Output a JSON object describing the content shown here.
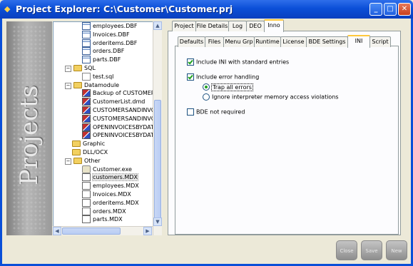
{
  "window": {
    "title": "Project Explorer: C:\\Customer\\Customer.prj",
    "title_icon": "diamond-icon",
    "controls": [
      "minimize-icon",
      "maximize-icon",
      "close-icon"
    ]
  },
  "banner": {
    "text": "Projects"
  },
  "tree": {
    "items": [
      {
        "label": "employees.DBF",
        "icon": "dbf-table-icon"
      },
      {
        "label": "Invoices.DBF",
        "icon": "dbf-table-icon"
      },
      {
        "label": "orderitems.DBF",
        "icon": "dbf-table-icon"
      },
      {
        "label": "orders.DBF",
        "icon": "dbf-table-icon"
      },
      {
        "label": "parts.DBF",
        "icon": "dbf-table-icon"
      },
      {
        "label": "SQL",
        "icon": "folder-icon",
        "expander": "−"
      },
      {
        "label": "test.sql",
        "icon": "sql-file-icon"
      },
      {
        "label": "Datamodule",
        "icon": "folder-icon",
        "expander": "−"
      },
      {
        "label": "Backup of CUSTOMERS",
        "icon": "datamodule-icon"
      },
      {
        "label": "CustomerList.dmd",
        "icon": "datamodule-icon"
      },
      {
        "label": "CUSTOMERSANDINVOI",
        "icon": "datamodule-icon"
      },
      {
        "label": "CUSTOMERSANDINVOI",
        "icon": "datamodule-icon"
      },
      {
        "label": "OPENINVOICESBYDATE",
        "icon": "datamodule-icon"
      },
      {
        "label": "OPENINVOICESBYDATE",
        "icon": "datamodule-icon"
      },
      {
        "label": "Graphic",
        "icon": "folder-icon"
      },
      {
        "label": "DLL/OCX",
        "icon": "folder-icon"
      },
      {
        "label": "Other",
        "icon": "folder-icon",
        "expander": "−"
      },
      {
        "label": "Customer.exe",
        "icon": "exe-file-icon"
      },
      {
        "label": "customers.MDX",
        "icon": "mdx-file-icon",
        "selected": true
      },
      {
        "label": "employees.MDX",
        "icon": "mdx-file-icon"
      },
      {
        "label": "Invoices.MDX",
        "icon": "mdx-file-icon"
      },
      {
        "label": "orderitems.MDX",
        "icon": "mdx-file-icon"
      },
      {
        "label": "orders.MDX",
        "icon": "mdx-file-icon"
      },
      {
        "label": "parts.MDX",
        "icon": "mdx-file-icon"
      }
    ]
  },
  "outer_tabs": [
    "Project",
    "File Details",
    "Log",
    "DEO",
    "Inno"
  ],
  "outer_active": "Inno",
  "inner_tabs": [
    "Defaults",
    "Files",
    "Menu Grp",
    "Runtime",
    "License",
    "BDE Settings",
    "INI",
    "Script"
  ],
  "inner_active": "INI",
  "ini": {
    "include_ini": {
      "label": "Include INI with standard entries",
      "checked": true
    },
    "include_error": {
      "label": "Include error handling",
      "checked": true
    },
    "trap_all": {
      "label": "Trap all errors",
      "selected": true
    },
    "ignore_violations": {
      "label": "Ignore interpreter memory access violations",
      "selected": false
    },
    "bde_not_required": {
      "label": "BDE not required",
      "checked": false
    }
  },
  "buttons": {
    "close": "Close",
    "save": "Save",
    "new": "New"
  }
}
